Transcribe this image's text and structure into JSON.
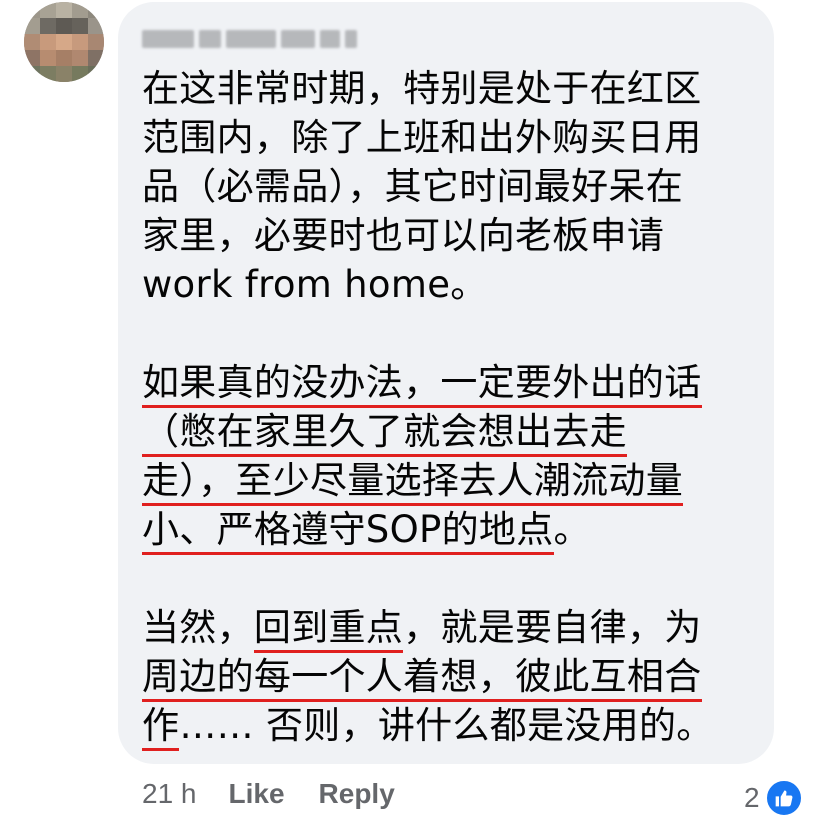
{
  "comment": {
    "author_name_blurred": "Curtis Chan",
    "paragraph1": [
      "在这非常时期，特别是处于在红区",
      "范围内，除了上班和出外购买日用",
      "品（必需品），其它时间最好呆在",
      "家里，必要时也可以向老板申请",
      "work from home。"
    ],
    "paragraph2": {
      "line1": "如果真的没办法，一定要外出的话",
      "line2": "（憋在家里久了就会想出去走",
      "line3": "走），至少尽量选择去人潮流动量",
      "line4_underlined": "小、严格遵守SOP的地点",
      "line4_tail": "。"
    },
    "paragraph3": {
      "line1_pre": "当然，",
      "line1_underlined": "回到重点",
      "line1_post": "，就是要自律，为",
      "line2": "周边的每一个人着想，彼此互相合",
      "line3_underlined": "作",
      "line3_tail": "…… 否则，讲什么都是没用的。"
    },
    "underline_color": "#e0201f"
  },
  "meta": {
    "time": "21 h",
    "like_label": "Like",
    "reply_label": "Reply",
    "reaction_count": "2",
    "reaction_icon": "thumbs-up-icon",
    "reaction_color": "#1877f2"
  }
}
